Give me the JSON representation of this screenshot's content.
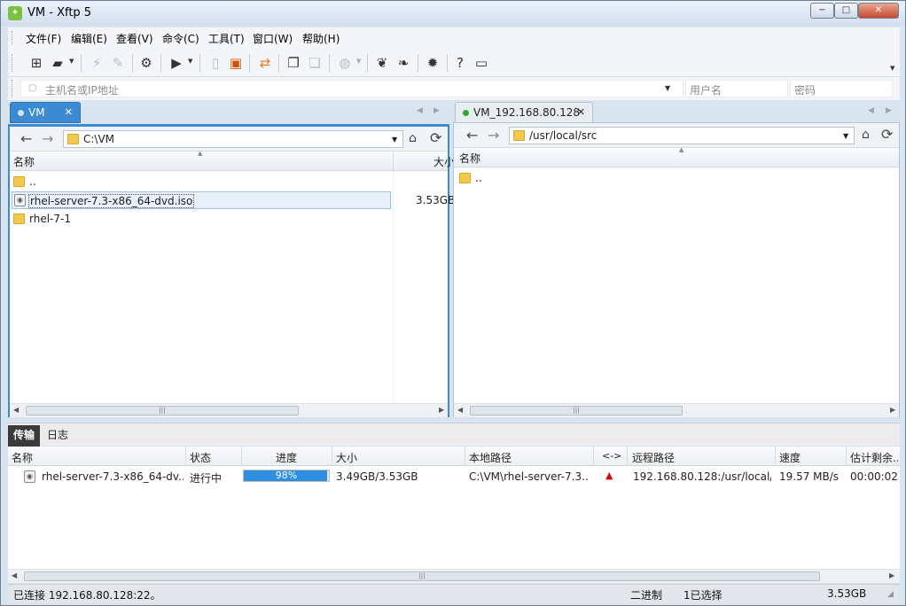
{
  "window": {
    "title": "VM - Xftp 5",
    "minimize": "−",
    "maximize": "□",
    "close": "✕"
  },
  "menu": [
    "文件(F)",
    "编辑(E)",
    "查看(V)",
    "命令(C)",
    "工具(T)",
    "窗口(W)",
    "帮助(H)"
  ],
  "address": {
    "host_placeholder": "主机名或IP地址",
    "user_placeholder": "用户名",
    "pass_placeholder": "密码"
  },
  "local": {
    "tab_label": "VM",
    "path": "C:\\VM",
    "col_name": "名称",
    "col_size": "大小",
    "rows": [
      {
        "name": "..",
        "size": "",
        "type": "folder"
      },
      {
        "name": "rhel-server-7.3-x86_64-dvd.iso",
        "size": "3.53GB",
        "type": "iso"
      },
      {
        "name": "rhel-7-1",
        "size": "",
        "type": "folder"
      }
    ]
  },
  "remote": {
    "tab_label": "VM_192.168.80.128",
    "path": "/usr/local/src",
    "col_name": "名称",
    "rows": [
      {
        "name": "..",
        "type": "folder"
      }
    ]
  },
  "bottom_tabs": [
    "传输",
    "日志"
  ],
  "transfer": {
    "headers": {
      "name": "名称",
      "status": "状态",
      "progress": "进度",
      "size": "大小",
      "local_path": "本地路径",
      "direction": "<->",
      "remote_path": "远程路径",
      "speed": "速度",
      "eta": "估计剩余..."
    },
    "row": {
      "name": "rhel-server-7.3-x86_64-dv...",
      "status": "进行中",
      "progress": 98,
      "progress_label": "98%",
      "size": "3.49GB/3.53GB",
      "local_path": "C:\\VM\\rhel-server-7.3...",
      "remote_path": "192.168.80.128:/usr/local/...",
      "speed": "19.57 MB/s",
      "eta": "00:00:02"
    }
  },
  "status": {
    "connection": "已连接 192.168.80.128:22。",
    "mode": "二进制",
    "selected": "1已选择",
    "size": "3.53GB"
  },
  "colors": {
    "accent": "#3b8ad2",
    "progress": "#2e8fe0",
    "connected_dot": "#2fa82f",
    "upload_arrow": "#cc1010"
  },
  "icons": {
    "back": "←",
    "forward": "→",
    "refresh": "⟳",
    "lock": "🔒",
    "up_arrow": "▲"
  }
}
